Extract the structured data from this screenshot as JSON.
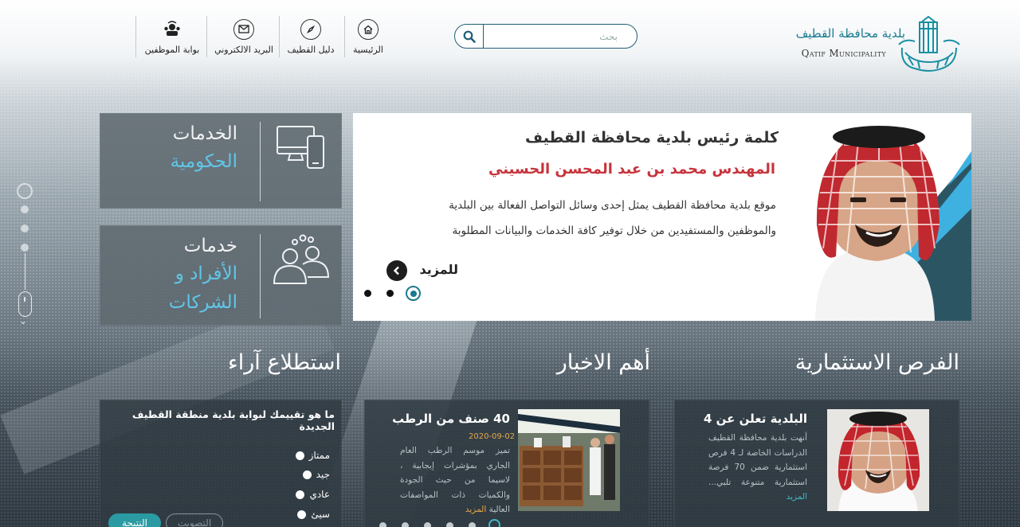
{
  "header": {
    "logo_ar": "بلدية محافظة القطيف",
    "logo_en": "Qatif Municipality",
    "search_placeholder": "بحث",
    "nav": [
      {
        "label": "الرئيسية",
        "icon": "home-icon"
      },
      {
        "label": "دليل القطيف",
        "icon": "compass-icon"
      },
      {
        "label": "البريد الالكتروني",
        "icon": "mail-icon"
      },
      {
        "label": "بوابة الموظفين",
        "icon": "employees-icon"
      }
    ]
  },
  "tiles": [
    {
      "line1": "الخدمات",
      "line2": "الحكومية",
      "icon": "devices-icon"
    },
    {
      "line1": "خدمات",
      "line2a": "الأفراد و",
      "line2b": "الشركات",
      "icon": "people-icon"
    }
  ],
  "slider": {
    "title": "كلمة رئيس بلدية محافظة القطيف",
    "subtitle": "المهندس محمد بن عبد المحسن الحسيني",
    "body_line1": "موقع بلدية محافظة القطيف يمثل إحدى وسائل التواصل الفعالة بين البلدية",
    "body_line2": "والموظفين والمستفيدين من خلال توفير كافة الخدمات والبيانات المطلوبة",
    "more": "للمزيد",
    "slide_count": 3,
    "active_slide": 3
  },
  "sections": {
    "investments": "الفرص الاستثمارية",
    "news": "أهم الاخبار",
    "poll": "استطلاع آراء"
  },
  "investment": {
    "title": "البلدية تعلن عن 4",
    "body": "أنهت بلدية محافظة القطيف الدراسات الخاصة لـ 4 فرص استثمارية ضمن 70 فرصة استثمارية متنوعة تلبي...",
    "more": "المزيد"
  },
  "news": {
    "title": "40 صنف من الرطب",
    "date": "2020-09-02",
    "body": "تميز موسم الرطب العام الجاري بمؤشرات إيجابية ، لاسيما من حيث الجودة والكميات ذات المواصفات العالية",
    "more": "المزيد"
  },
  "poll": {
    "question": "ما هو تقييمك لبوابة بلدية منطقة القطيف الجديدة",
    "options": [
      "ممتاز",
      "جيد",
      "عادي",
      "سيئ"
    ],
    "result_button": "النتيجة",
    "vote_button": "التصويت"
  },
  "colors": {
    "brand_teal": "#1a7a8f",
    "accent_cyan": "#5fc7e8",
    "slider_red": "#c6343c",
    "link_orange": "#e9a94a"
  }
}
